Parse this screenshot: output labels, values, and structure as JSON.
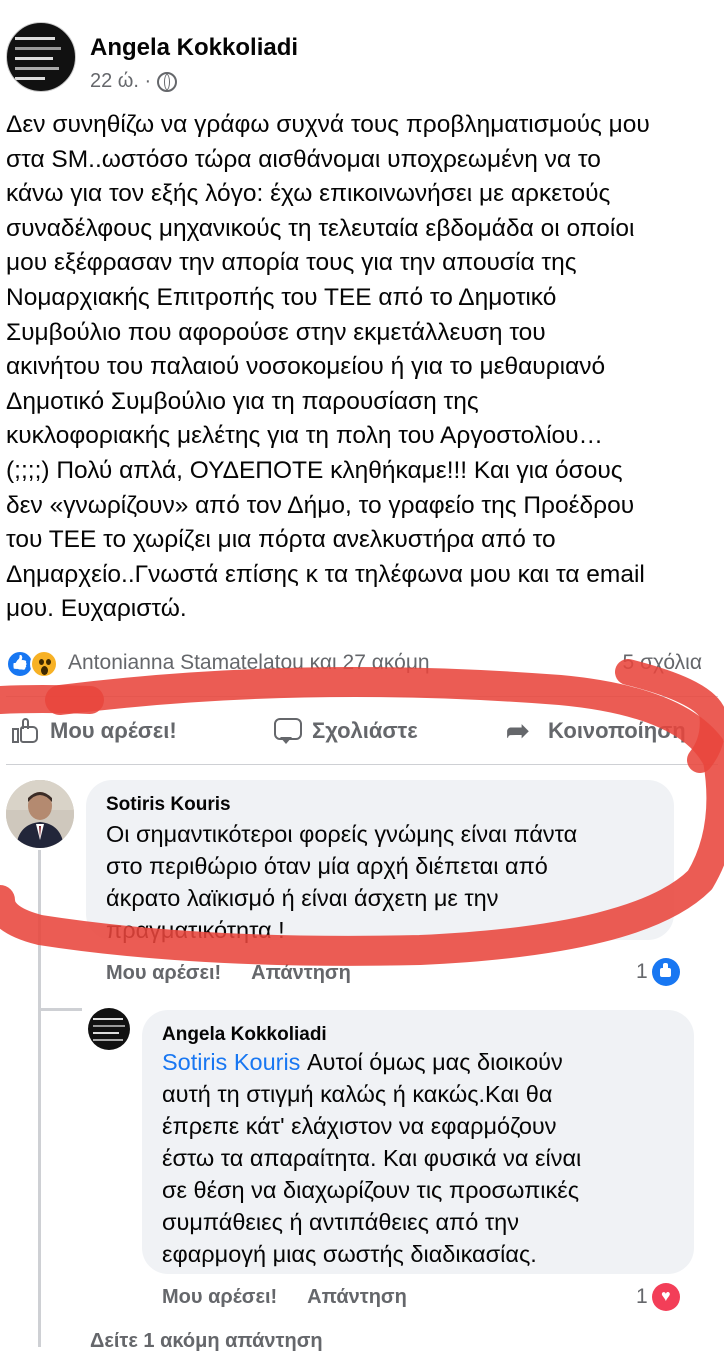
{
  "post": {
    "author": "Angela Kokkoliadi",
    "time": "22 ώ. ·",
    "privacy_icon": "globe-icon",
    "text": "Δεν συνηθίζω να γράφω συχνά τους προβληματισμούς μου\nστα SM..ωστόσο τώρα αισθάνομαι υποχρεωμένη να το\nκάνω για τον εξής λόγο: έχω επικοινωνήσει με αρκετούς\nσυναδέλφους μηχανικούς τη τελευταία εβδομάδα οι οποίοι\nμου εξέφρασαν την απορία τους για την απουσία της\nΝομαρχιακής Επιτροπής του ΤΕΕ από το Δημοτικό\nΣυμβούλιο που αφορούσε στην εκμετάλλευση του\nακινήτου του παλαιού νοσοκομείου ή για το μεθαυριανό\nΔημοτικό Συμβούλιο για τη παρουσίαση της\nκυκλοφοριακής μελέτης για τη πολη του Αργοστολίου…\n(;;;;) Πολύ απλά, ΟΥΔΕΠΟΤΕ κληθήκαμε!!! Και για όσους\nδεν «γνωρίζουν» από τον Δήμο, το γραφείο της Προέδρου\nτου ΤΕΕ το χωρίζει μια πόρτα ανελκυστήρα από το\nΔημαρχείο..Γνωστά επίσης κ τα τηλέφωνα μου και τα email\nμου. Ευχαριστώ.",
    "reactors": "Antonianna Stamatelatou και 27 ακόμη",
    "comments_count": "5 σχόλια"
  },
  "actions": {
    "like": "Μου αρέσει!",
    "comment": "Σχολιάστε",
    "share": "Κοινοποίηση"
  },
  "comments": [
    {
      "author": "Sotiris Kouris",
      "text": "Οι σημαντικότεροι φορείς γνώμης είναι πάντα\nστο περιθώριο όταν μία αρχή διέπεται από\nάκρατο λαϊκισμό ή είναι άσχετη με την\nπραγματικότητα !",
      "like_label": "Μου αρέσει!",
      "reply_label": "Απάντηση",
      "reaction_count": "1",
      "reaction_icon": "like-icon"
    },
    {
      "author": "Angela Kokkoliadi",
      "mention": "Sotiris Kouris",
      "text": " Αυτοί όμως μας διοικούν\nαυτή τη στιγμή καλώς ή κακώς.Και θα\nέπρεπε κάτ' ελάχιστον να εφαρμόζουν\nέστω τα απαραίτητα. Και φυσικά να είναι\nσε θέση να διαχωρίζουν τις προσωπικές\nσυμπάθειες ή αντιπάθειες από την\nεφαρμογή μιας σωστής διαδικασίας.",
      "like_label": "Μου αρέσει!",
      "reply_label": "Απάντηση",
      "reaction_count": "1",
      "reaction_icon": "heart-icon"
    }
  ],
  "more_replies": "Δείτε 1 ακόμη απάντηση",
  "colors": {
    "accent": "#1877f2",
    "annotation_red": "#e8453c",
    "secondary_text": "#65676b",
    "bubble_bg": "#f0f2f5"
  }
}
